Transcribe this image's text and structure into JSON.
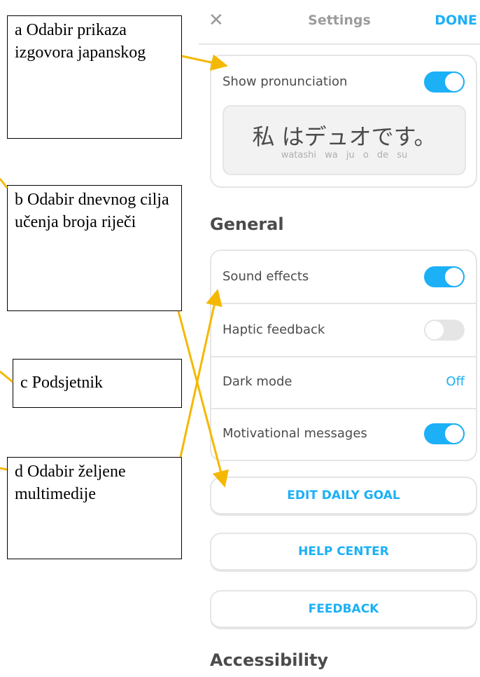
{
  "header": {
    "close_glyph": "✕",
    "title": "Settings",
    "done": "DONE"
  },
  "pronunciation": {
    "label": "Show pronunciation",
    "enabled": true,
    "japanese": "私 はデュオです。",
    "romaji": "watashi wa ju o de su"
  },
  "general": {
    "title": "General",
    "items": [
      {
        "label": "Sound effects",
        "enabled": true
      },
      {
        "label": "Haptic feedback",
        "enabled": false
      },
      {
        "label": "Dark mode",
        "value": "Off"
      },
      {
        "label": "Motivational messages",
        "enabled": true
      }
    ]
  },
  "buttons": {
    "edit_goal": "EDIT DAILY GOAL",
    "help_center": "HELP CENTER",
    "feedback": "FEEDBACK"
  },
  "accessibility_title": "Accessibility",
  "annotations": [
    "a Odabir prikaza izgovora japanskog",
    "b Odabir dnevnog cilja učenja broja riječi",
    "c Podsjetnik",
    "d Odabir željene multimedije"
  ],
  "colors": {
    "accent": "#1cb0f6",
    "arrow": "#f5b800",
    "text": "#4b4b4b",
    "border": "#e5e5e5"
  }
}
